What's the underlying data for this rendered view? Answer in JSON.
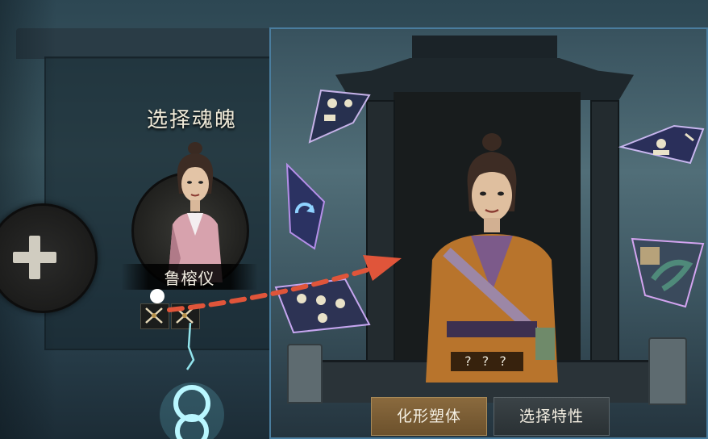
{
  "header": {
    "title": "选择魂魄"
  },
  "current_soul": {
    "name": "鲁榕仪",
    "traits": [
      {
        "icon": "crossed-swords-icon"
      },
      {
        "icon": "crossed-swords-icon"
      }
    ]
  },
  "add_slot": {
    "icon": "plus-icon"
  },
  "preview": {
    "name_placeholder": "? ? ?"
  },
  "shards": [
    {
      "icon": "shard-cloud-scroll-icon"
    },
    {
      "icon": "shard-refresh-icon"
    },
    {
      "icon": "shard-figures-icon"
    },
    {
      "icon": "shard-fortune-icon"
    },
    {
      "icon": "shard-serpent-icon"
    }
  ],
  "actions": {
    "transform_label": "化形塑体",
    "select_trait_label": "选择特性"
  },
  "colors": {
    "accent_arrow": "#e0553a",
    "panel_border": "#4a7d9e",
    "primary_button": "#7a5d35",
    "glow": "#8ff2ff"
  }
}
